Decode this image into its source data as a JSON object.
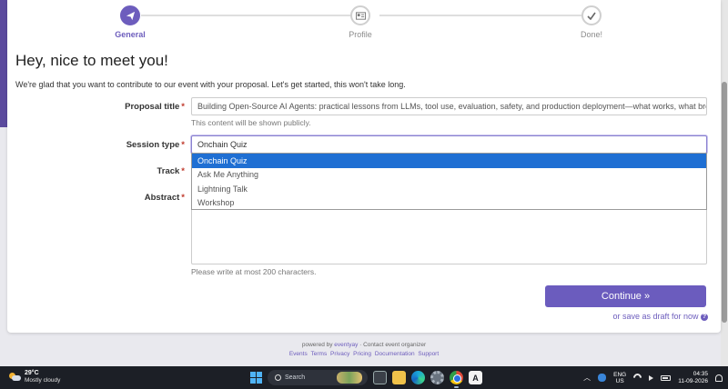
{
  "wizard": {
    "steps": [
      {
        "label": "General",
        "icon": "paper-plane-icon",
        "state": "active"
      },
      {
        "label": "Profile",
        "icon": "id-card-icon",
        "state": "pending"
      },
      {
        "label": "Done!",
        "icon": "check-icon",
        "state": "pending"
      }
    ]
  },
  "form": {
    "heading": "Hey, nice to meet you!",
    "intro": "We're glad that you want to contribute to our event with your proposal. Let's get started, this won't take long.",
    "required_mark": "*",
    "proposal_title": {
      "label": "Proposal title",
      "value": "Building Open-Source AI Agents: practical lessons from LLMs, tool use, evaluation, safety, and production deployment—what works, what breaks",
      "help": "This content will be shown publicly."
    },
    "session_type": {
      "label": "Session type",
      "value": "Onchain Quiz",
      "options": [
        "Onchain Quiz",
        "Ask Me Anything",
        "Lightning Talk",
        "Workshop"
      ],
      "selected_index": 0
    },
    "track": {
      "label": "Track"
    },
    "abstract": {
      "label": "Abstract",
      "help": "Please write at most 200 characters."
    },
    "continue_label": "Continue »",
    "draft_label": "or save as draft for now",
    "draft_icon": "question-circle-icon"
  },
  "footer": {
    "powered_prefix": "powered by",
    "brand": "eventyay",
    "contact": "· Contact event organizer",
    "links": [
      "Events",
      "Terms",
      "Privacy",
      "Pricing",
      "Documentation",
      "Support"
    ]
  },
  "taskbar": {
    "temperature": "29°C",
    "condition": "Mostly cloudy",
    "search_placeholder": "Search",
    "lang_top": "ENG",
    "lang_bottom": "US",
    "time": "04:35",
    "date": "11-09-2026",
    "accent": "#6b5cbe"
  }
}
